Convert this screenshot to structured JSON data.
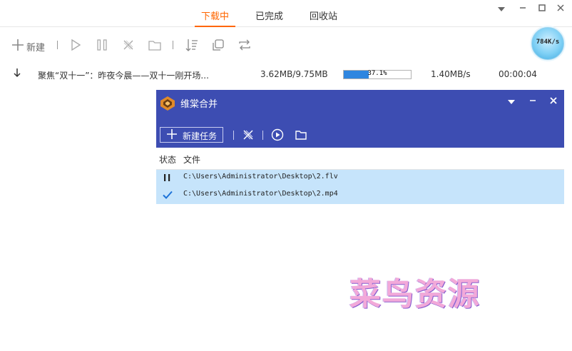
{
  "tabs": [
    {
      "label": "下载中",
      "active": true
    },
    {
      "label": "已完成",
      "active": false
    },
    {
      "label": "回收站",
      "active": false
    }
  ],
  "window_controls": {
    "menu": "menu-icon",
    "minimize": "minimize-icon",
    "maximize": "maximize-icon",
    "close": "close-icon"
  },
  "toolbar": {
    "new_label": "新建",
    "icons": [
      "plus-icon",
      "play-icon",
      "pause-icon",
      "delete-icon",
      "folder-icon",
      "sort-icon",
      "copy-icon",
      "refresh-icon"
    ]
  },
  "speed_ball": {
    "value": "784K/s"
  },
  "download": {
    "name": "聚焦“双十一”：昨夜今晨——双十一刚开场...",
    "size": "3.62MB/9.75MB",
    "progress_label": "37.1%",
    "progress": 37.1,
    "speed": "1.40MB/s",
    "time": "00:00:04"
  },
  "dialog": {
    "title": "维棠合并",
    "new_task_label": "新建任务",
    "columns": {
      "state": "状态",
      "file": "文件"
    },
    "files": [
      {
        "state": "paused",
        "state_icon": "pause-icon",
        "path": "C:\\Users\\Administrator\\Desktop\\2.flv"
      },
      {
        "state": "done",
        "state_icon": "checkmark-icon",
        "path": "C:\\Users\\Administrator\\Desktop\\2.mp4"
      }
    ]
  },
  "watermark": "菜鸟资源",
  "colors": {
    "accent": "#ff6600",
    "dialog_header": "#3d4db2",
    "row_selected": "#c6e4fb",
    "progress": "#2f86e0"
  }
}
